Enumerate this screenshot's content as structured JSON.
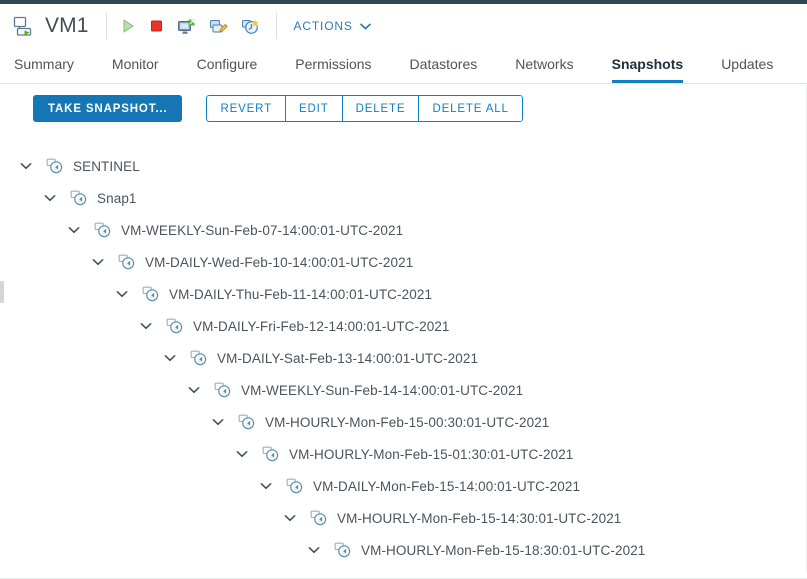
{
  "header": {
    "vm_icon": "virtual-machine-powered-on-icon",
    "title": "VM1",
    "operation_icons": [
      {
        "name": "power-on-icon",
        "title": "Power On"
      },
      {
        "name": "power-off-icon",
        "title": "Power Off"
      },
      {
        "name": "launch-remote-console-icon",
        "title": "Launch Remote Console"
      },
      {
        "name": "edit-settings-icon",
        "title": "Edit Settings"
      },
      {
        "name": "take-snapshot-icon",
        "title": "Take Snapshot"
      }
    ],
    "actions_label": "ACTIONS",
    "actions_chevron": "chevron-down-icon"
  },
  "tabs": [
    {
      "label": "Summary",
      "active": false
    },
    {
      "label": "Monitor",
      "active": false
    },
    {
      "label": "Configure",
      "active": false
    },
    {
      "label": "Permissions",
      "active": false
    },
    {
      "label": "Datastores",
      "active": false
    },
    {
      "label": "Networks",
      "active": false
    },
    {
      "label": "Snapshots",
      "active": true
    },
    {
      "label": "Updates",
      "active": false
    }
  ],
  "toolbar": {
    "take_snapshot_label": "TAKE SNAPSHOT...",
    "revert_label": "REVERT",
    "edit_label": "EDIT",
    "delete_label": "DELETE",
    "delete_all_label": "DELETE ALL"
  },
  "colors": {
    "accent": "#0f80c5",
    "primary_button": "#1476b5",
    "header_strip": "#344452",
    "text": "#4a545c"
  },
  "tree": {
    "expand_icon": "chevron-down-icon",
    "node_icon": "snapshot-icon",
    "nodes": [
      {
        "label": "SENTINEL",
        "depth": 0
      },
      {
        "label": "Snap1",
        "depth": 1
      },
      {
        "label": "VM-WEEKLY-Sun-Feb-07-14:00:01-UTC-2021",
        "depth": 2
      },
      {
        "label": "VM-DAILY-Wed-Feb-10-14:00:01-UTC-2021",
        "depth": 3
      },
      {
        "label": "VM-DAILY-Thu-Feb-11-14:00:01-UTC-2021",
        "depth": 4
      },
      {
        "label": "VM-DAILY-Fri-Feb-12-14:00:01-UTC-2021",
        "depth": 5
      },
      {
        "label": "VM-DAILY-Sat-Feb-13-14:00:01-UTC-2021",
        "depth": 6
      },
      {
        "label": "VM-WEEKLY-Sun-Feb-14-14:00:01-UTC-2021",
        "depth": 7
      },
      {
        "label": "VM-HOURLY-Mon-Feb-15-00:30:01-UTC-2021",
        "depth": 8
      },
      {
        "label": "VM-HOURLY-Mon-Feb-15-01:30:01-UTC-2021",
        "depth": 9
      },
      {
        "label": "VM-DAILY-Mon-Feb-15-14:00:01-UTC-2021",
        "depth": 10
      },
      {
        "label": "VM-HOURLY-Mon-Feb-15-14:30:01-UTC-2021",
        "depth": 11
      },
      {
        "label": "VM-HOURLY-Mon-Feb-15-18:30:01-UTC-2021",
        "depth": 12
      }
    ]
  }
}
